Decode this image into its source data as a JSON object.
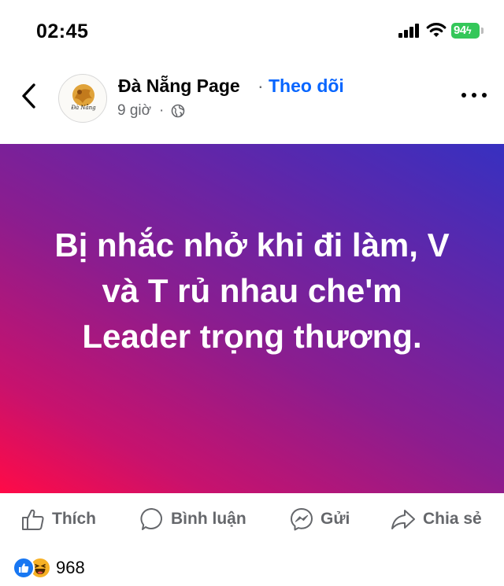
{
  "status_bar": {
    "time": "02:45",
    "battery": "94",
    "signal_icon": "cellular-signal-icon",
    "wifi_icon": "wifi-icon"
  },
  "header": {
    "page_name": "Đà Nẵng Page",
    "separator": "·",
    "follow_label": "Theo dõi",
    "time_ago": "9 giờ",
    "meta_separator": "·",
    "audience_icon": "globe-icon",
    "avatar_text": "Đà Nẵng"
  },
  "post": {
    "text": "Bị nhắc nhở khi đi làm, V và T rủ nhau che'm Leader trọng thương.",
    "gradient_colors": [
      "#ff0a47",
      "#8b1d8f",
      "#3730c0"
    ]
  },
  "actions": {
    "like": "Thích",
    "comment": "Bình luận",
    "send": "Gửi",
    "share": "Chia sẻ"
  },
  "reactions": {
    "count": "968",
    "types": [
      "like-reaction-icon",
      "haha-reaction-icon"
    ]
  },
  "colors": {
    "accent": "#0866ff",
    "secondary_text": "#65676b",
    "battery": "#34c759"
  }
}
